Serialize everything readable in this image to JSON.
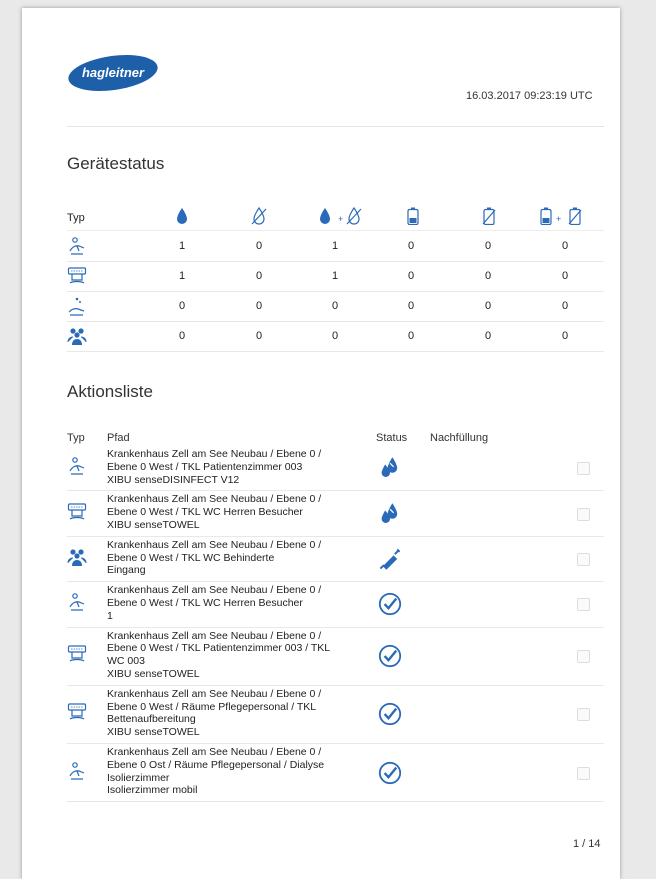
{
  "header": {
    "logo_text": "hagleitner",
    "timestamp": "16.03.2017 09:23:19 UTC"
  },
  "device_status": {
    "title": "Gerätestatus",
    "type_label": "Typ",
    "column_icons": [
      "drop-icon",
      "drop-crossed-icon",
      "drop-plus-drop-crossed-icon",
      "battery-icon",
      "battery-crossed-icon",
      "battery-plus-battery-crossed-icon"
    ],
    "rows": [
      {
        "type_icon": "hand-disinfect-icon",
        "values": [
          "1",
          "0",
          "1",
          "0",
          "0",
          "0"
        ]
      },
      {
        "type_icon": "towel-dispenser-icon",
        "values": [
          "1",
          "0",
          "1",
          "0",
          "0",
          "0"
        ]
      },
      {
        "type_icon": "hand-wash-icon",
        "values": [
          "0",
          "0",
          "0",
          "0",
          "0",
          "0"
        ]
      },
      {
        "type_icon": "people-group-icon",
        "values": [
          "0",
          "0",
          "0",
          "0",
          "0",
          "0"
        ]
      }
    ]
  },
  "action_list": {
    "title": "Aktionsliste",
    "headers": {
      "type": "Typ",
      "path": "Pfad",
      "status": "Status",
      "refill": "Nachfüllung"
    },
    "rows": [
      {
        "type_icon": "hand-disinfect-icon",
        "status_icon": "drops-icon",
        "path": [
          "Krankenhaus Zell am See Neubau / Ebene 0 /",
          "Ebene 0 West / TKL Patientenzimmer 003",
          "XIBU senseDISINFECT V12"
        ]
      },
      {
        "type_icon": "towel-dispenser-icon",
        "status_icon": "drops-icon",
        "path": [
          "Krankenhaus Zell am See Neubau / Ebene 0 /",
          "Ebene 0 West / TKL WC Herren Besucher",
          "XIBU senseTOWEL"
        ]
      },
      {
        "type_icon": "people-group-icon",
        "status_icon": "syringe-icon",
        "path": [
          "Krankenhaus Zell am See Neubau / Ebene 0 /",
          "Ebene 0 West / TKL WC Behinderte",
          "Eingang"
        ]
      },
      {
        "type_icon": "hand-disinfect-icon",
        "status_icon": "check-circle-icon",
        "path": [
          "Krankenhaus Zell am See Neubau / Ebene 0 /",
          "Ebene 0 West / TKL WC Herren Besucher",
          "1"
        ]
      },
      {
        "type_icon": "towel-dispenser-icon",
        "status_icon": "check-circle-icon",
        "path": [
          "Krankenhaus Zell am See Neubau / Ebene 0 /",
          "Ebene 0 West / TKL Patientenzimmer 003 / TKL",
          "WC 003",
          "XIBU senseTOWEL"
        ]
      },
      {
        "type_icon": "towel-dispenser-icon",
        "status_icon": "check-circle-icon",
        "path": [
          "Krankenhaus Zell am See Neubau / Ebene 0 /",
          "Ebene 0 West / Räume Pflegepersonal / TKL",
          "Bettenaufbereitung",
          "XIBU senseTOWEL"
        ]
      },
      {
        "type_icon": "hand-disinfect-icon",
        "status_icon": "check-circle-icon",
        "path": [
          "Krankenhaus Zell am See Neubau / Ebene 0 /",
          "Ebene 0 Ost / Räume Pflegepersonal / Dialyse",
          "Isolierzimmer",
          "Isolierzimmer mobil"
        ]
      }
    ]
  },
  "footer": {
    "page": "1 / 14"
  },
  "colors": {
    "brand_blue": "#1d5fa8",
    "icon_blue": "#2a6ab8"
  }
}
